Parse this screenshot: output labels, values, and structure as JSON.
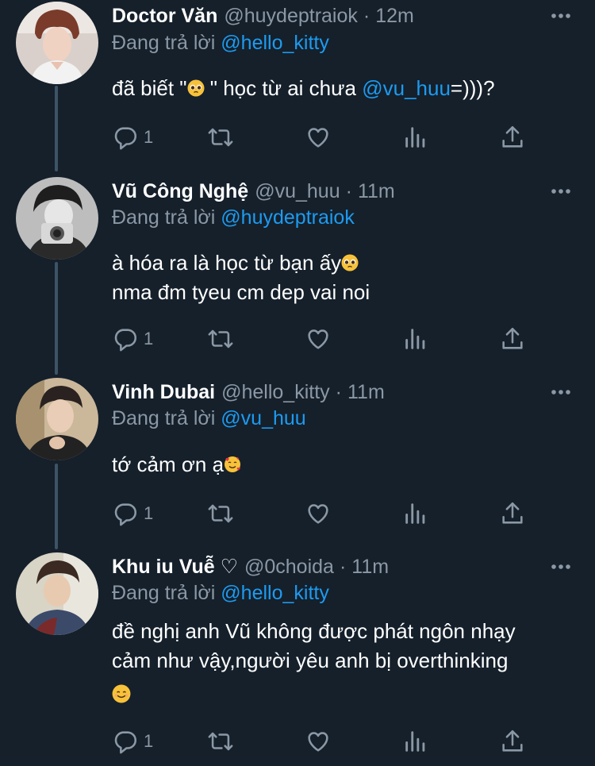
{
  "reply_prefix": "Đang trả lời",
  "tweets": [
    {
      "name": "Doctor Văn",
      "handle": "@huydeptraiok",
      "separator": "·",
      "time": "12m",
      "replying_to": "@hello_kitty",
      "text_before": "đã biết \"",
      "emoji1": "pleading-face-emoji",
      "text_middle": " \" học từ ai chưa ",
      "mention": "@vu_huu",
      "text_after": "=)))?",
      "reply_count": "1"
    },
    {
      "name": "Vũ Công Nghệ",
      "handle": "@vu_huu",
      "separator": "·",
      "time": "11m",
      "replying_to": "@huydeptraiok",
      "line1": "à hóa ra là học từ bạn ấy",
      "emoji1": "pleading-face-emoji",
      "line2": "nma đm tyeu cm dep vai noi",
      "reply_count": "1"
    },
    {
      "name": "Vinh Dubai",
      "handle": "@hello_kitty",
      "separator": "·",
      "time": "11m",
      "replying_to": "@vu_huu",
      "line1": "tớ cảm ơn ạ",
      "emoji1": "smiling-face-with-hearts-emoji",
      "reply_count": "1"
    },
    {
      "name": "Khu iu Vuễ ♡",
      "handle": "@0choida",
      "separator": "·",
      "time": "11m",
      "replying_to": "@hello_kitty",
      "line1": "đề nghị anh Vũ không được phát ngôn nhạy",
      "line2": "cảm như vậy,người yêu anh bị overthinking",
      "emoji1": "smiling-face-emoji",
      "reply_count": "1"
    }
  ],
  "colors": {
    "background": "#15202b",
    "secondary_text": "#8b98a5",
    "mention": "#1d9bf0",
    "thread_line": "#3d5466"
  },
  "icons": [
    "more-icon",
    "reply-icon",
    "retweet-icon",
    "like-icon",
    "analytics-icon",
    "share-icon"
  ]
}
